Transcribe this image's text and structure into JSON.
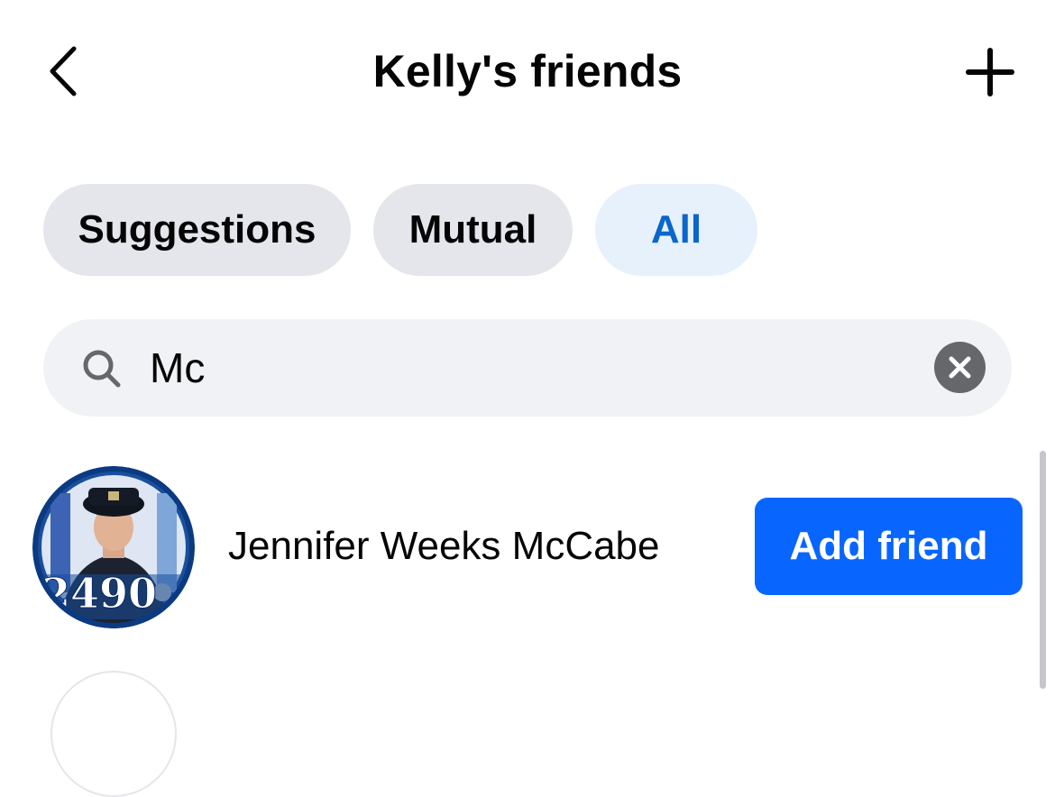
{
  "header": {
    "title": "Kelly's friends",
    "back_icon": "chevron-left-icon",
    "add_icon": "plus-icon"
  },
  "filters": {
    "chips": [
      {
        "label": "Suggestions",
        "selected": false
      },
      {
        "label": "Mutual",
        "selected": false
      },
      {
        "label": "All",
        "selected": true
      }
    ]
  },
  "search": {
    "value": "Mc",
    "icon": "search-icon",
    "clear_icon": "close-icon"
  },
  "results": [
    {
      "name": "Jennifer Weeks McCabe",
      "action_label": "Add friend",
      "avatar_text": "2490"
    }
  ],
  "colors": {
    "primary": "#0866ff",
    "chip_bg": "#e4e6eb",
    "chip_selected_bg": "#e7f1fc",
    "chip_selected_text": "#0866cc",
    "search_bg": "#f0f2f5",
    "text": "#050505"
  }
}
